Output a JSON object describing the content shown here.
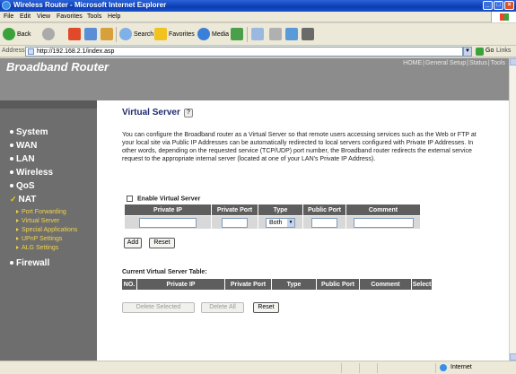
{
  "window": {
    "title": "Wireless Router - Microsoft Internet Explorer"
  },
  "menu": [
    "File",
    "Edit",
    "View",
    "Favorites",
    "Tools",
    "Help"
  ],
  "toolbar": {
    "back": "Back",
    "search": "Search",
    "favorites": "Favorites",
    "media": "Media"
  },
  "address": {
    "label": "Address",
    "url": "http://192.168.2.1/index.asp",
    "go": "Go",
    "links": "Links"
  },
  "router": {
    "brand": "Broadband Router",
    "top_links": [
      "HOME",
      "General Setup",
      "Status",
      "Tools"
    ]
  },
  "sidebar": {
    "items": [
      {
        "label": "System"
      },
      {
        "label": "WAN"
      },
      {
        "label": "LAN"
      },
      {
        "label": "Wireless"
      },
      {
        "label": "QoS"
      },
      {
        "label": "NAT"
      },
      {
        "label": "Firewall"
      }
    ],
    "nat_sub": [
      "Port Forwarding",
      "Virtual Server",
      "Special Applications",
      "UPnP Settings",
      "ALG Settings"
    ]
  },
  "main": {
    "title": "Virtual Server",
    "description": "You can configure the Broadband router as a Virtual Server so that remote users accessing services such as the Web or FTP at your local site via Public IP Addresses can be automatically redirected to local servers configured with Private IP Addresses. In other words, depending on the requested service (TCP/UDP) port number, the Broadband router redirects the external service request to the appropriate internal server (located at one of your LAN's Private IP Address).",
    "enable_label": "Enable Virtual Server",
    "entry_columns": [
      "Private IP",
      "Private Port",
      "Type",
      "Public Port",
      "Comment"
    ],
    "type_value": "Both",
    "add_label": "Add",
    "reset_label": "Reset",
    "current_title": "Current Virtual Server Table:",
    "current_columns": [
      "NO.",
      "Private IP",
      "Private Port",
      "Type",
      "Public Port",
      "Comment",
      "Select"
    ],
    "delete_selected_label": "Delete Selected",
    "delete_all_label": "Delete All",
    "reset2_label": "Reset"
  },
  "status": {
    "zone": "Internet"
  }
}
